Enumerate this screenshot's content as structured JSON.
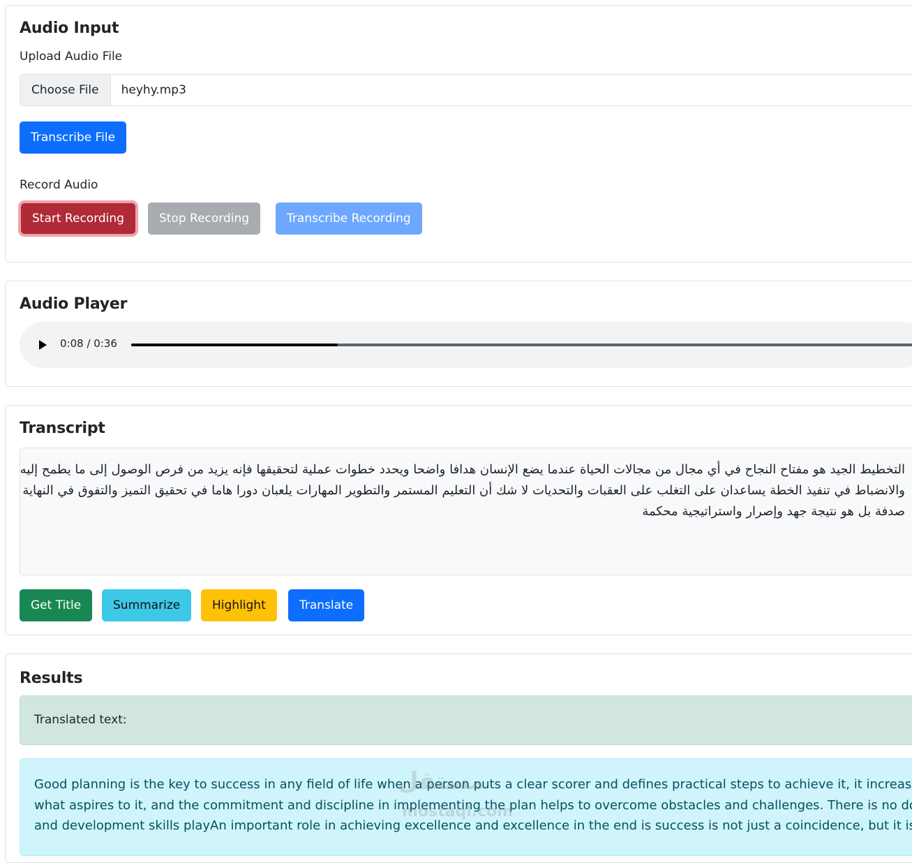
{
  "audio_input": {
    "title": "Audio Input",
    "upload_label": "Upload Audio File",
    "choose_file": "Choose File",
    "file_name": "heyhy.mp3",
    "transcribe_file": "Transcribe File",
    "record_label": "Record Audio",
    "start_recording": "Start Recording",
    "stop_recording": "Stop Recording",
    "transcribe_recording": "Transcribe Recording"
  },
  "audio_player": {
    "title": "Audio Player",
    "time": "0:08 / 0:36",
    "progress": 0.222,
    "play_icon": "play-icon"
  },
  "transcript": {
    "title": "Transcript",
    "text": "التخطيط الجيد هو مفتاح النجاح في أي مجال من مجالات الحياة عندما يضع الإنسان هدافا واضحا ويحدد خطوات عملية لتحقيقها فإنه يزيد من فرص الوصول إلى ما يطمح إليه كما أن الالتزام\nوالانضباط في تنفيذ الخطة يساعدان على التغلب على العقبات والتحديات لا شك أن التعليم المستمر والتطوير المهارات يلعبان دورا هاما في تحقيق التميز والتفوق في النهاية النجاح ليس مجرد\nصدفة بل هو نتيجة جهد وإصرار واستراتيجية محكمة",
    "buttons": {
      "get_title": "Get Title",
      "summarize": "Summarize",
      "highlight": "Highlight",
      "translate": "Translate"
    }
  },
  "results": {
    "title": "Results",
    "translated_label": "Translated text:",
    "translated_text": "Good planning is the key to success in any field of life when a person puts a clear scorer and defines practical steps to achieve it, it increases the\nwhat aspires to it, and the commitment and discipline in implementing the plan helps to overcome obstacles and challenges. There is no doubt\nand development skills playAn important role in achieving excellence and excellence in the end is success is not just a coincidence, but it is the r",
    "watermark": "مستقل",
    "watermark_sub": "mostaql.com"
  },
  "colors": {
    "primary": "#0d6efd",
    "danger": "#b02a37",
    "success": "#198754",
    "info": "#3dc8e8",
    "warning": "#ffc107",
    "alert_success_bg": "#d1e7dd",
    "alert_info_bg": "#cff4fc"
  }
}
